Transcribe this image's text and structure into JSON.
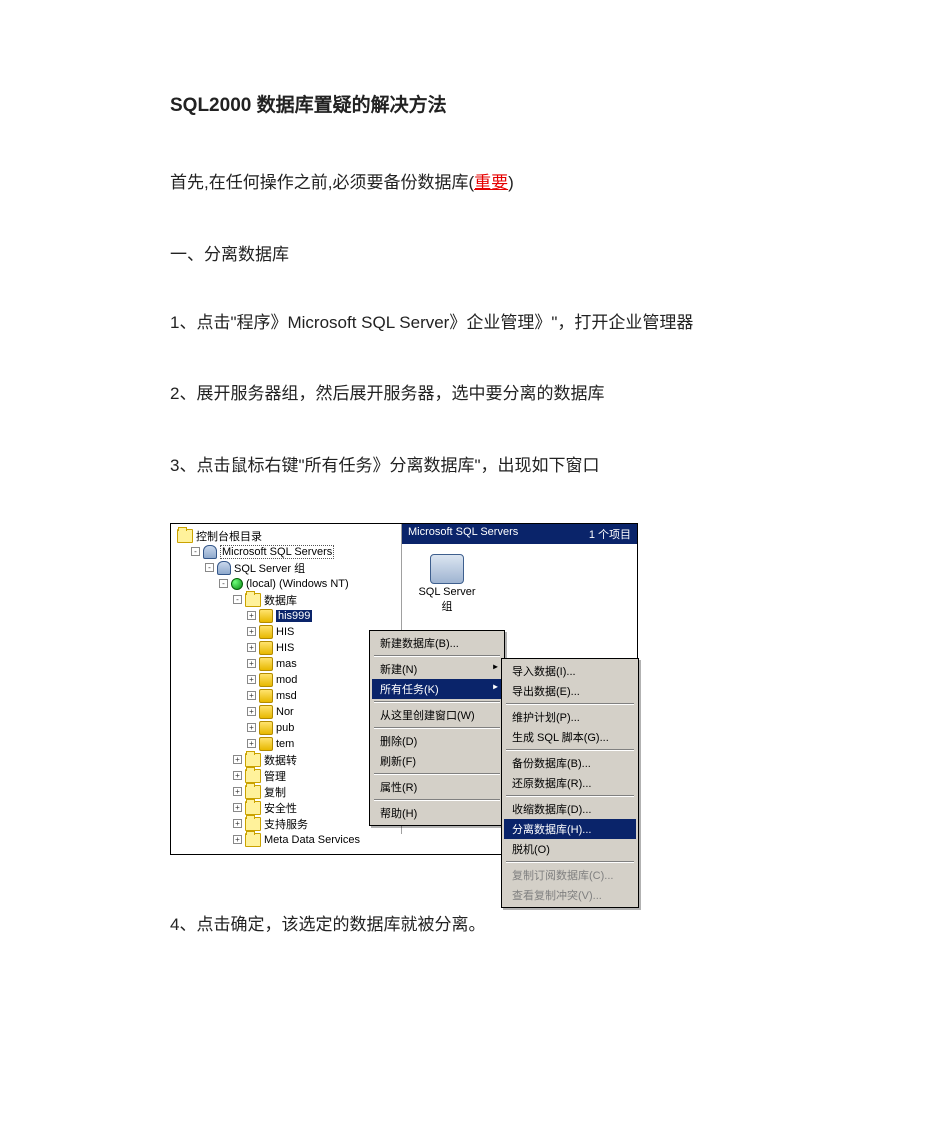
{
  "document": {
    "title": "SQL2000 数据库置疑的解决方法",
    "intro_prefix": "首先,在任何操作之前,必须要备份数据库(",
    "intro_em": "重要",
    "intro_suffix": ")",
    "section1": "一、分离数据库",
    "step1": "1、点击\"程序》Microsoft SQL Server》企业管理》\"，打开企业管理器",
    "step2": "2、展开服务器组，然后展开服务器，选中要分离的数据库",
    "step3": "3、点击鼠标右键\"所有任务》分离数据库\"，出现如下窗口",
    "step4": "4、点击确定，该选定的数据库就被分离。"
  },
  "screenshot": {
    "tree": {
      "root": "控制台根目录",
      "sqlservers": "Microsoft SQL Servers",
      "group": "SQL Server 组",
      "local": "(local) (Windows NT)",
      "databases": "数据库",
      "db_items": [
        "his999",
        "HIS",
        "HIS",
        "mas",
        "mod",
        "msd",
        "Nor",
        "pub",
        "tem"
      ],
      "after_db": [
        "数据转",
        "管理",
        "复制",
        "安全性",
        "支持服务",
        "Meta Data Services"
      ]
    },
    "list": {
      "header_left": "Microsoft SQL Servers",
      "header_right": "1 个项目",
      "item_label1": "SQL Server",
      "item_label2": "组"
    },
    "context_menu": {
      "items": [
        {
          "label": "新建数据库(B)...",
          "type": "item"
        },
        {
          "type": "sep"
        },
        {
          "label": "新建(N)",
          "type": "arrow"
        },
        {
          "label": "所有任务(K)",
          "type": "arrow-sel"
        },
        {
          "type": "sep"
        },
        {
          "label": "从这里创建窗口(W)",
          "type": "item"
        },
        {
          "type": "sep"
        },
        {
          "label": "删除(D)",
          "type": "item"
        },
        {
          "label": "刷新(F)",
          "type": "item"
        },
        {
          "type": "sep"
        },
        {
          "label": "属性(R)",
          "type": "item"
        },
        {
          "type": "sep"
        },
        {
          "label": "帮助(H)",
          "type": "item"
        }
      ]
    },
    "submenu": {
      "items": [
        {
          "label": "导入数据(I)...",
          "type": "item"
        },
        {
          "label": "导出数据(E)...",
          "type": "item"
        },
        {
          "type": "sep"
        },
        {
          "label": "维护计划(P)...",
          "type": "item"
        },
        {
          "label": "生成 SQL 脚本(G)...",
          "type": "item"
        },
        {
          "type": "sep"
        },
        {
          "label": "备份数据库(B)...",
          "type": "item"
        },
        {
          "label": "还原数据库(R)...",
          "type": "item"
        },
        {
          "type": "sep"
        },
        {
          "label": "收缩数据库(D)...",
          "type": "item"
        },
        {
          "label": "分离数据库(H)...",
          "type": "item-sel"
        },
        {
          "label": "脱机(O)",
          "type": "item"
        },
        {
          "type": "sep"
        },
        {
          "label": "复制订阅数据库(C)...",
          "type": "disabled"
        },
        {
          "label": "查看复制冲突(V)...",
          "type": "disabled"
        }
      ]
    }
  }
}
